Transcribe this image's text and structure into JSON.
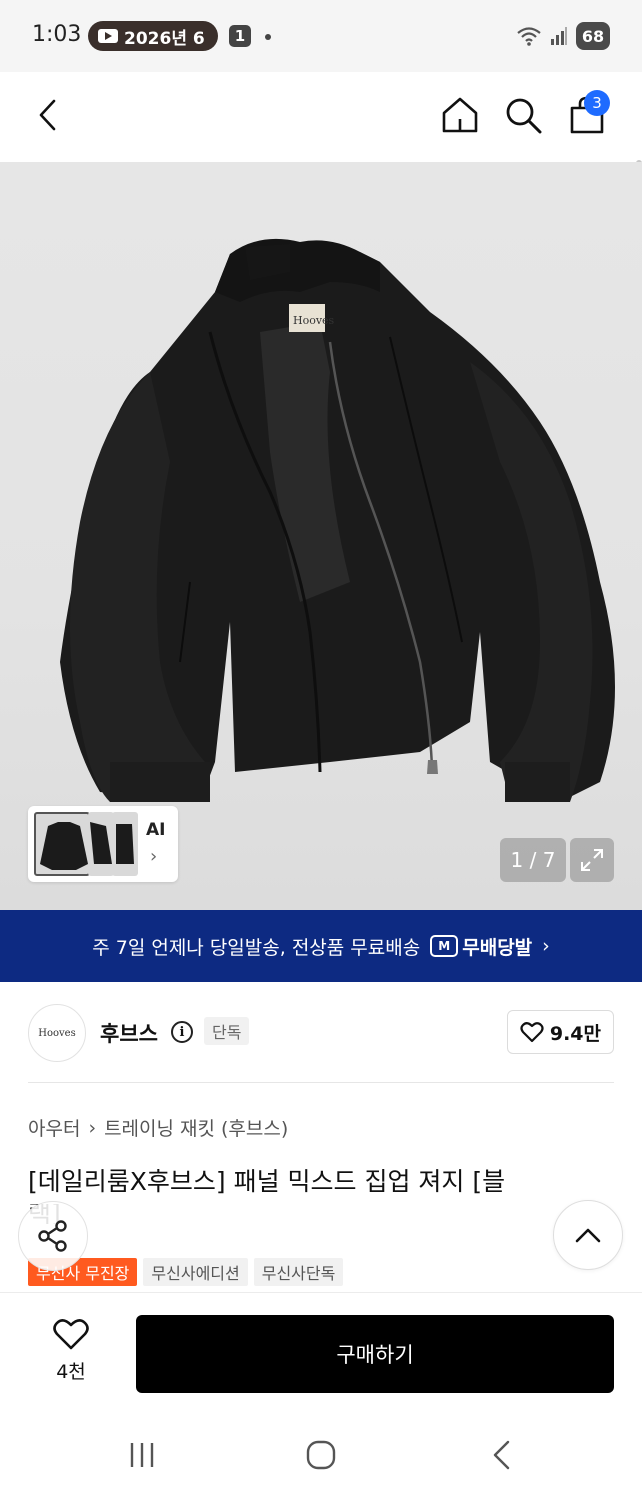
{
  "status_bar": {
    "time": "1:03",
    "notification_pill": "2026년 6",
    "notification_count": "1",
    "battery": "68"
  },
  "header": {
    "cart_count": "3"
  },
  "gallery": {
    "thumb_label": "AI",
    "thumb_chevron": "›",
    "counter": "1 / 7",
    "image_brand_label": "Hooves"
  },
  "banner": {
    "text": "주 7일 언제나 당일발송, 전상품 무료배송",
    "logo_letter": "M",
    "logo_text": "무배당발",
    "chevron": "›"
  },
  "brand": {
    "logo_text": "Hooves",
    "name": "후브스",
    "info_symbol": "i",
    "tag": "단독",
    "likes": "9.4만"
  },
  "breadcrumb": {
    "category": "아우터",
    "separator": "›",
    "subcategory": "트레이닝 재킷 (후브스)"
  },
  "product": {
    "title": "[데일리룸X후브스] 패널 믹스드 집업 져지 [블",
    "title_cont": "랙]",
    "tags": [
      "무신사 무진장",
      "무신사에디션",
      "무신사단독"
    ]
  },
  "action_bar": {
    "wish_count": "4천",
    "buy_label": "구매하기"
  },
  "colors": {
    "banner_bg": "#0d2a82",
    "accent_blue": "#1e6bff",
    "tag_orange": "#ff5a1f",
    "buy_bg": "#000000"
  },
  "icons": [
    "back-arrow-icon",
    "home-icon",
    "search-icon",
    "cart-icon",
    "expand-icon",
    "info-icon",
    "heart-icon",
    "share-icon",
    "chevron-up-icon",
    "recent-apps-icon",
    "home-circle-icon",
    "nav-back-icon",
    "wifi-icon",
    "signal-icon"
  ]
}
